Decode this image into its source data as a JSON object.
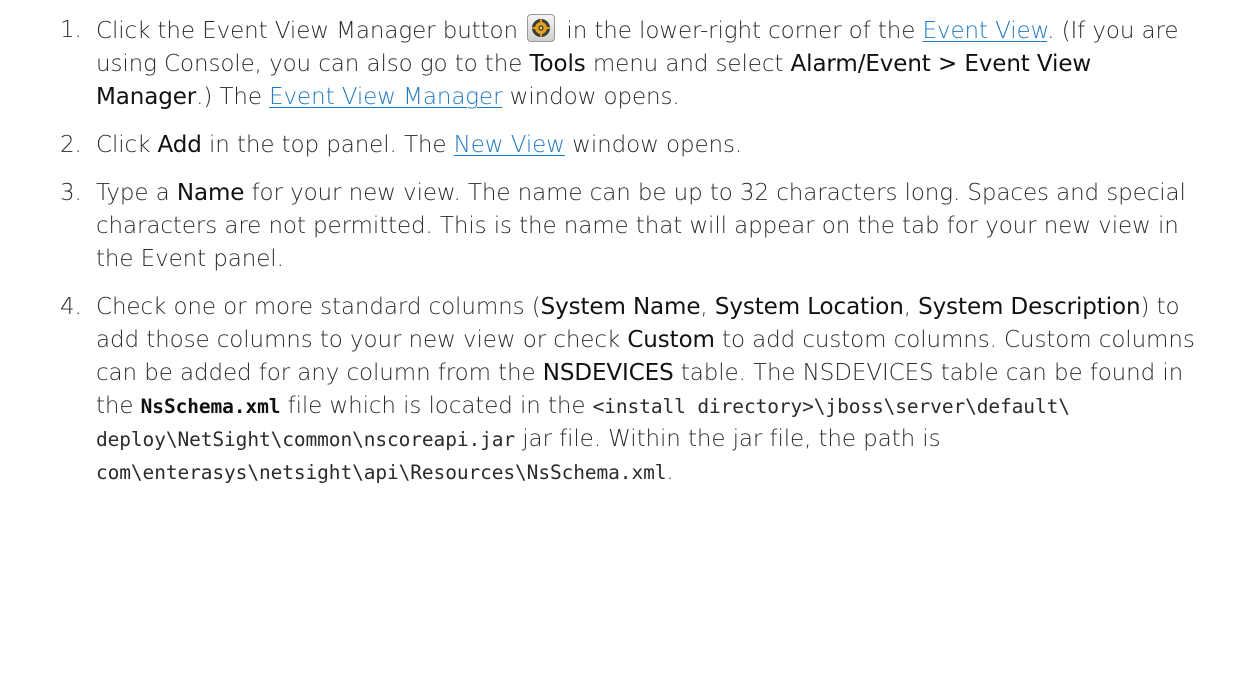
{
  "steps": [
    {
      "number": "1.",
      "part_a": "Click the Event View Manager button",
      "part_b": " in the lower-right corner of the ",
      "link_event_view": "Event View",
      "part_c": ". (If you are using Console, you can also go to the ",
      "bold_tools": "Tools",
      "part_d": " menu and select ",
      "bold_alarm": "Alarm/Event > Event View Manager",
      "part_e": ".) The ",
      "link_manager": "Event View Manager",
      "part_f": " window opens.",
      "icon": "gear-icon"
    },
    {
      "number": "2.",
      "part_a": "Click ",
      "bold_add": "Add",
      "part_b": " in the top panel. The ",
      "link_new_view": "New View",
      "part_c": " window opens."
    },
    {
      "number": "3.",
      "part_a": "Type a ",
      "bold_name": "Name",
      "part_b": " for your new view. The name can be up to 32 characters long. Spaces and special characters are not permitted. This is the name that will appear on the tab for your new view in the Event panel."
    },
    {
      "number": "4.",
      "part_a": "Check one or more standard columns (",
      "bold_sysname": "System Name",
      "sep1": ", ",
      "bold_sysloc": "System Location",
      "sep2": ", ",
      "bold_sysdesc": "System Description",
      "part_b": ") to add those columns to your new view or check ",
      "bold_custom": "Custom",
      "part_c": " to add custom columns. Custom columns can be added for any column from the ",
      "bold_nsdevices": "NSDEVICES",
      "part_d": " table. The NSDEVICES table can be found in the ",
      "code_schema": "NsSchema.xml",
      "part_e": " file which is located in the ",
      "code_dir1": "<install directory>\\jboss\\server\\default\\",
      "code_dir2": "deploy\\NetSight\\common\\nscoreapi.jar",
      "part_f": " jar file. Within the jar file, the path is ",
      "code_path": "com\\enterasys\\netsight\\api\\Resources\\NsSchema.xml",
      "part_g": "."
    }
  ],
  "colors": {
    "text": "#2b2b2b",
    "link": "#1f79c5",
    "background": "#ffffff"
  }
}
